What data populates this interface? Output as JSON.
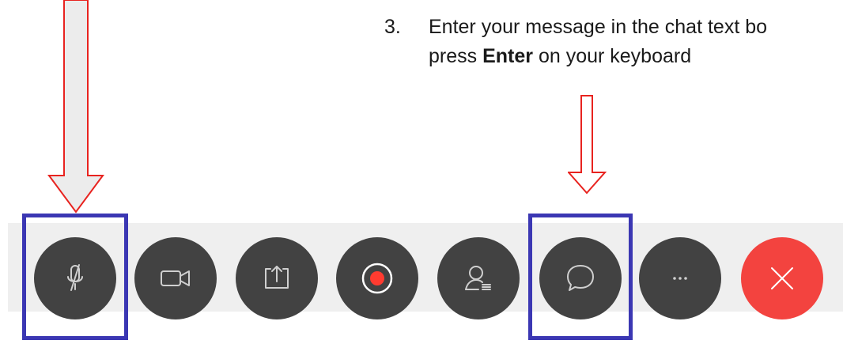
{
  "instruction": {
    "number": "3.",
    "line1": "Enter your message in the chat text bo",
    "line2_prefix": "press ",
    "line2_bold": "Enter",
    "line2_suffix": " on your keyboard"
  },
  "toolbar": {
    "buttons": [
      {
        "icon": "microphone-muted-icon",
        "label": ""
      },
      {
        "icon": "video-camera-icon",
        "label": ""
      },
      {
        "icon": "share-screen-icon",
        "label": ""
      },
      {
        "icon": "record-icon",
        "label": ""
      },
      {
        "icon": "participants-icon",
        "label": ""
      },
      {
        "icon": "chat-bubble-icon",
        "label": ""
      },
      {
        "icon": "more-options-icon",
        "label": ""
      },
      {
        "icon": "close-icon",
        "label": ""
      }
    ]
  },
  "colors": {
    "button_bg": "#424242",
    "end_button_bg": "#f3433f",
    "toolbar_bg": "#efefef",
    "highlight_border": "#3b37b3",
    "arrow_stroke": "#e8231f",
    "arrow_fill": "#ececec",
    "record_dot": "#ff3b30"
  },
  "annotations": {
    "highlights": [
      "mute-button",
      "chat-button"
    ],
    "arrows": [
      "arrow-to-mute",
      "arrow-to-chat"
    ]
  }
}
